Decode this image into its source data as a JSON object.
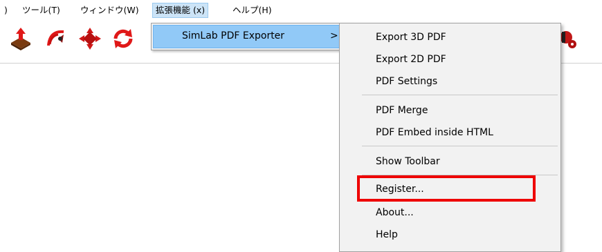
{
  "menubar": {
    "items": [
      {
        "label": ")"
      },
      {
        "label": "ツール(T)"
      },
      {
        "label": "ウィンドウ(W)"
      },
      {
        "label": "拡張機能 (x)"
      },
      {
        "label": "ヘルプ(H)"
      }
    ]
  },
  "toolbar": {
    "icons": [
      "push-pull-icon",
      "follow-me-icon",
      "move-icon",
      "rotate-icon",
      "extension-icon"
    ]
  },
  "extensions_menu": {
    "items": [
      {
        "label": "SimLab PDF Exporter",
        "arrow": ">"
      }
    ]
  },
  "pdf_exporter_menu": {
    "items": [
      {
        "label": "Export 3D PDF"
      },
      {
        "label": "Export 2D PDF"
      },
      {
        "label": "PDF Settings"
      },
      {
        "label": "PDF Merge"
      },
      {
        "label": "PDF Embed inside HTML"
      },
      {
        "label": "Show Toolbar"
      },
      {
        "label": "Register..."
      },
      {
        "label": "About..."
      },
      {
        "label": "Help"
      }
    ]
  },
  "colors": {
    "highlight_border": "#ee0000",
    "menu_hover": "#91c9f7",
    "menubar_active": "#cce4f7"
  }
}
